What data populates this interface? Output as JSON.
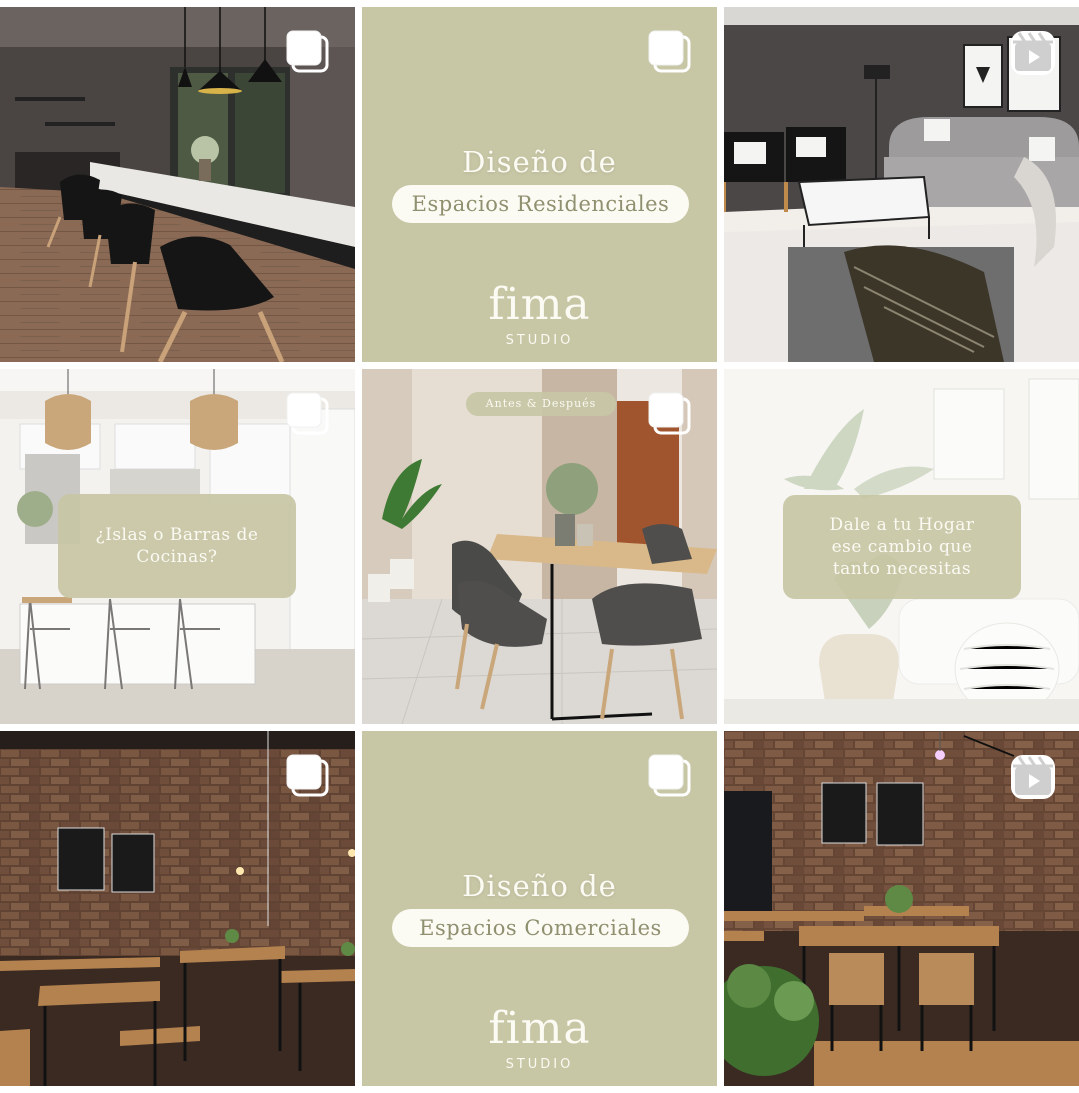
{
  "colors": {
    "sage": "#c7c6a5",
    "cream": "#fbfaf3",
    "pill_text": "#8f906f"
  },
  "posts": [
    {
      "id": "post-1",
      "kind": "carousel",
      "icon": "multiple-images-icon"
    },
    {
      "id": "post-2",
      "kind": "carousel",
      "icon": "multiple-images-icon",
      "title": "Diseño de",
      "pill": "Espacios Residenciales",
      "brand": "fima",
      "brand_sub": "STUDIO"
    },
    {
      "id": "post-3",
      "kind": "reel",
      "icon": "reel-icon"
    },
    {
      "id": "post-4",
      "kind": "carousel",
      "icon": "multiple-images-icon",
      "overlay_line1": "¿Islas o Barras de",
      "overlay_line2": "Cocinas?"
    },
    {
      "id": "post-5",
      "kind": "carousel",
      "icon": "multiple-images-icon",
      "tag": "Antes & Después"
    },
    {
      "id": "post-6",
      "kind": "photo",
      "overlay_line1": "Dale a tu Hogar",
      "overlay_line2": "ese cambio que",
      "overlay_line3": "tanto necesitas"
    },
    {
      "id": "post-7",
      "kind": "carousel",
      "icon": "multiple-images-icon"
    },
    {
      "id": "post-8",
      "kind": "carousel",
      "icon": "multiple-images-icon",
      "title": "Diseño de",
      "pill": "Espacios Comerciales",
      "brand": "fima",
      "brand_sub": "STUDIO"
    },
    {
      "id": "post-9",
      "kind": "reel",
      "icon": "reel-icon"
    }
  ]
}
